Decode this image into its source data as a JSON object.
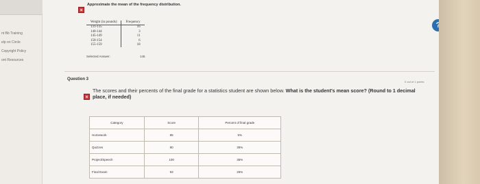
{
  "sidebar": {
    "items": [
      {
        "label": "nt Bb Training"
      },
      {
        "label": "elp on Circle"
      },
      {
        "label": "Copyright Policy"
      },
      {
        "label": "ont Resources"
      }
    ]
  },
  "previous_question": {
    "title": "Approximate the mean of the frequency distribution.",
    "table": {
      "headers": [
        "Weight (in pounds)",
        "Frequency"
      ],
      "rows": [
        [
          "131-135",
          "16"
        ],
        [
          "140-144",
          "3"
        ],
        [
          "145-149",
          "11"
        ],
        [
          "150-154",
          "6"
        ],
        [
          "155-159",
          "18"
        ]
      ]
    },
    "selected_answer_label": "Selected Answer:",
    "selected_answer_value": "145"
  },
  "help": {
    "label": "?"
  },
  "question": {
    "label": "Question 3",
    "points": "0 out of 1 points",
    "prompt": "The scores and their percents of the final grade for a statistics student are shown below.",
    "prompt_bold": "What is the student's mean score? (Round to 1 decimal place, if needed)",
    "table": {
      "headers": [
        "Category",
        "Score",
        "Percent of final grade"
      ],
      "rows": [
        [
          "Homework",
          "85",
          "5%"
        ],
        [
          "Quizzes",
          "80",
          "35%"
        ],
        [
          "Project/Speech",
          "100",
          "35%"
        ],
        [
          "Final Exam",
          "93",
          "25%"
        ]
      ]
    }
  },
  "colors": {
    "incorrect_icon": "#c8383a",
    "help_button": "#2b6fb0"
  }
}
